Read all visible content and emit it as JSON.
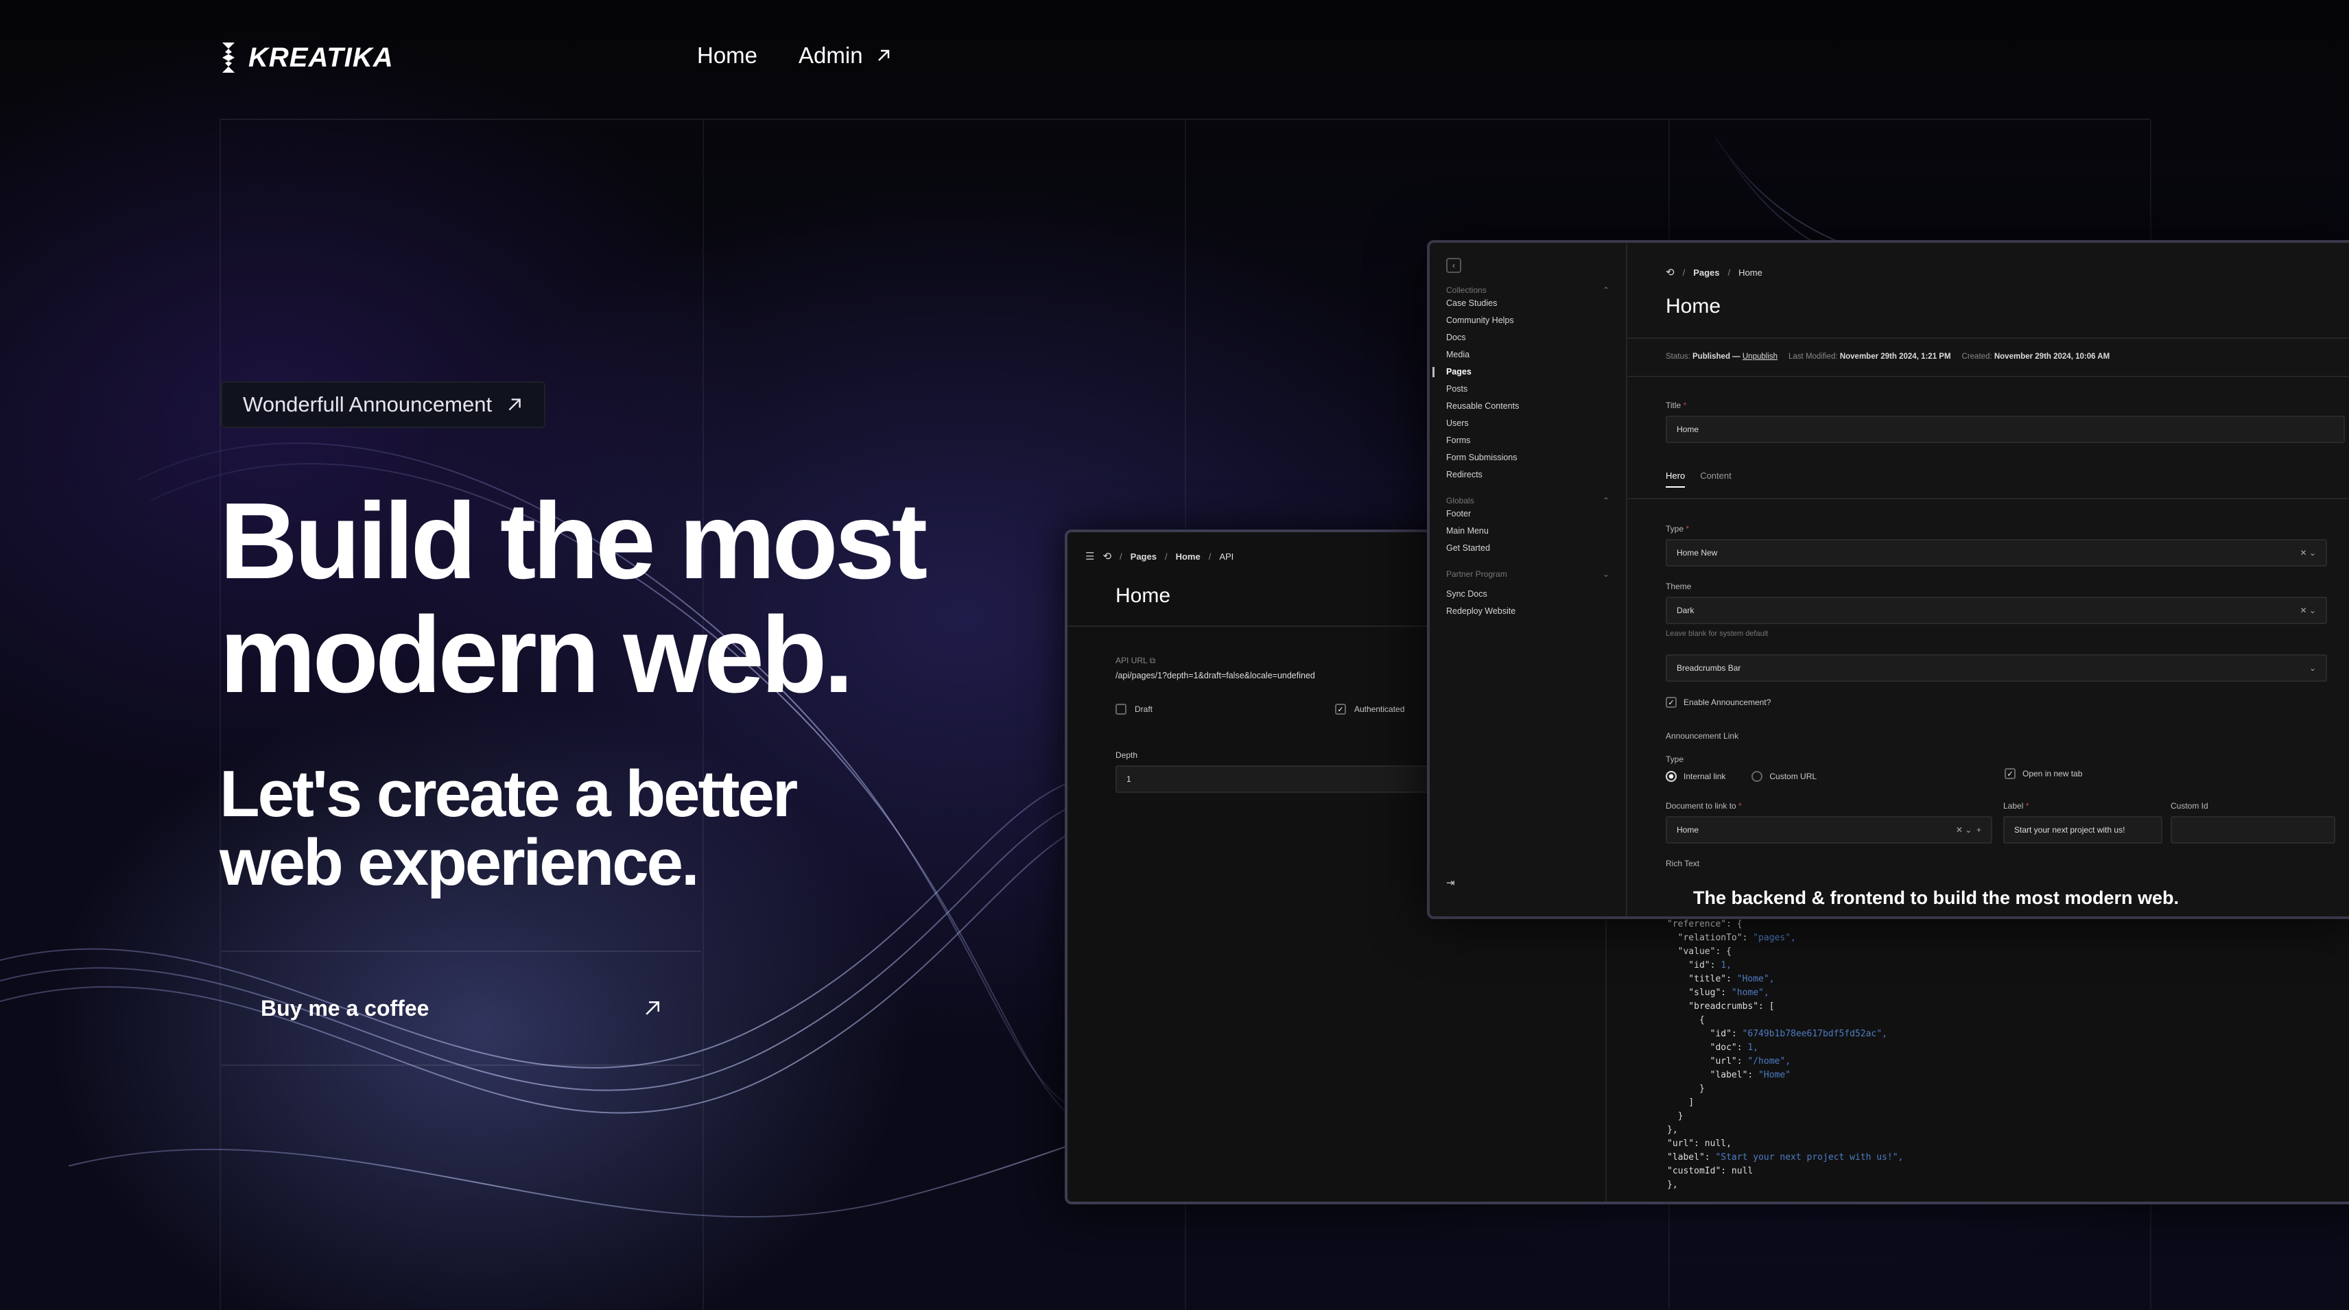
{
  "brand": {
    "name": "KREATIKA"
  },
  "nav": {
    "home": "Home",
    "admin": "Admin"
  },
  "announcement": {
    "label": "Wonderfull Announcement"
  },
  "hero": {
    "title_line1": "Build the most",
    "title_line2": "modern web.",
    "subtitle_line1": "Let's create a better",
    "subtitle_line2": "web experience.",
    "cta": "Buy me a coffee"
  },
  "api_panel": {
    "crumb1": "Pages",
    "crumb2": "Home",
    "crumb3": "API",
    "title": "Home",
    "api_url_label": "API URL",
    "api_url": "/api/pages/1?depth=1&draft=false&locale=undefined",
    "draft_label": "Draft",
    "auth_label": "Authenticated",
    "depth_label": "Depth",
    "depth_value": "1"
  },
  "admin_panel": {
    "crumb1": "Pages",
    "crumb2": "Home",
    "title": "Home",
    "status_label": "Status:",
    "status_value": "Published —",
    "unpublish": "Unpublish",
    "modified_label": "Last Modified:",
    "modified_value": "November 29th 2024, 1:21 PM",
    "created_label": "Created:",
    "created_value": "November 29th 2024, 10:06 AM",
    "title_label": "Title",
    "title_value": "Home",
    "tabs": [
      "Hero",
      "Content"
    ],
    "type_label": "Type",
    "type_value": "Home New",
    "theme_label": "Theme",
    "theme_value": "Dark",
    "theme_hint": "Leave blank for system default",
    "breadcrumbs_value": "Breadcrumbs Bar",
    "enable_announcement": "Enable Announcement?",
    "announcement_link": "Announcement Link",
    "link_type_label": "Type",
    "internal_link": "Internal link",
    "custom_url": "Custom URL",
    "open_new_tab": "Open in new tab",
    "doc_label": "Document to link to",
    "doc_value": "Home",
    "label_label": "Label",
    "label_value": "Start your next project with us!",
    "custom_id_label": "Custom Id",
    "rich_text_label": "Rich Text",
    "rich_text": "The backend & frontend to build the most modern web."
  },
  "sidebar": {
    "collections_label": "Collections",
    "collections": [
      "Case Studies",
      "Community Helps",
      "Docs",
      "Media",
      "Pages",
      "Posts",
      "Reusable Contents",
      "Users",
      "Forms",
      "Form Submissions",
      "Redirects"
    ],
    "globals_label": "Globals",
    "globals": [
      "Footer",
      "Main Menu",
      "Get Started"
    ],
    "partner_label": "Partner Program",
    "actions": [
      "Sync Docs",
      "Redeploy Website"
    ]
  },
  "code_lines": [
    [
      "\"reference\": {",
      ""
    ],
    [
      "  \"relationTo\": ",
      "\"pages\","
    ],
    [
      "  \"value\": {",
      ""
    ],
    [
      "    \"id\": ",
      "1,"
    ],
    [
      "    \"title\": ",
      "\"Home\","
    ],
    [
      "    \"slug\": ",
      "\"home\","
    ],
    [
      "    \"breadcrumbs\": [",
      ""
    ],
    [
      "      {",
      ""
    ],
    [
      "        \"id\": ",
      "\"6749b1b78ee617bdf5fd52ac\","
    ],
    [
      "        \"doc\": ",
      "1,"
    ],
    [
      "        \"url\": ",
      "\"/home\","
    ],
    [
      "        \"label\": ",
      "\"Home\""
    ],
    [
      "      }",
      ""
    ],
    [
      "    ]",
      ""
    ],
    [
      "  }",
      ""
    ],
    [
      "},",
      ""
    ],
    [
      "\"url\": null,",
      ""
    ],
    [
      "\"label\": ",
      "\"Start your next project with us!\","
    ],
    [
      "\"customId\": null",
      ""
    ],
    [
      "},",
      ""
    ]
  ]
}
